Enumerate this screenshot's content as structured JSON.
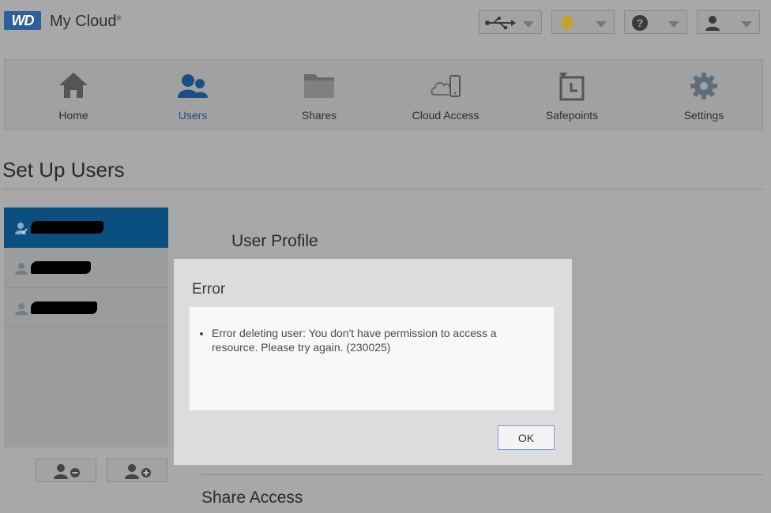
{
  "header": {
    "logo_text": "WD",
    "product_name": "My Cloud",
    "product_mark": "®",
    "buttons": [
      {
        "name": "usb",
        "icon": "usb-icon"
      },
      {
        "name": "alerts",
        "icon": "bell-icon"
      },
      {
        "name": "help",
        "icon": "help-icon"
      },
      {
        "name": "user",
        "icon": "user-icon"
      }
    ]
  },
  "nav": {
    "items": [
      {
        "label": "Home",
        "icon": "home-icon"
      },
      {
        "label": "Users",
        "icon": "users-icon",
        "active": true
      },
      {
        "label": "Shares",
        "icon": "folder-icon"
      },
      {
        "label": "Cloud Access",
        "icon": "cloud-device-icon"
      },
      {
        "label": "Safepoints",
        "icon": "safepoint-icon"
      },
      {
        "label": "Settings",
        "icon": "gear-icon"
      }
    ]
  },
  "page": {
    "title": "Set Up Users",
    "user_profile_heading": "User Profile",
    "share_access_heading": "Share Access"
  },
  "users": {
    "rows": [
      {
        "selected": true
      },
      {
        "selected": false
      },
      {
        "selected": false
      }
    ],
    "remove_icon": "remove-user-icon",
    "add_icon": "add-user-icon"
  },
  "dialog": {
    "title": "Error",
    "messages": [
      "Error deleting user: You don't have permission to access a resource. Please try again. (230025)"
    ],
    "ok_label": "OK"
  },
  "colors": {
    "accent": "#0a4f80",
    "active_nav_text": "#1b4d86",
    "ok_border": "#7a9fd0"
  }
}
